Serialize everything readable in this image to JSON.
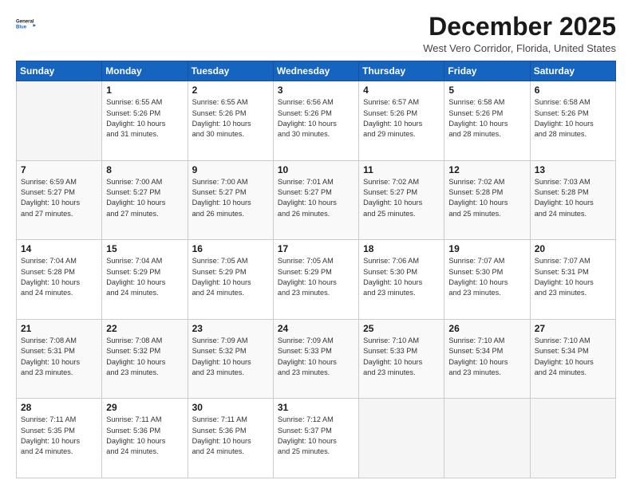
{
  "logo": {
    "line1": "General",
    "line2": "Blue"
  },
  "title": "December 2025",
  "location": "West Vero Corridor, Florida, United States",
  "weekdays": [
    "Sunday",
    "Monday",
    "Tuesday",
    "Wednesday",
    "Thursday",
    "Friday",
    "Saturday"
  ],
  "weeks": [
    [
      {
        "day": "",
        "info": ""
      },
      {
        "day": "1",
        "info": "Sunrise: 6:55 AM\nSunset: 5:26 PM\nDaylight: 10 hours\nand 31 minutes."
      },
      {
        "day": "2",
        "info": "Sunrise: 6:55 AM\nSunset: 5:26 PM\nDaylight: 10 hours\nand 30 minutes."
      },
      {
        "day": "3",
        "info": "Sunrise: 6:56 AM\nSunset: 5:26 PM\nDaylight: 10 hours\nand 30 minutes."
      },
      {
        "day": "4",
        "info": "Sunrise: 6:57 AM\nSunset: 5:26 PM\nDaylight: 10 hours\nand 29 minutes."
      },
      {
        "day": "5",
        "info": "Sunrise: 6:58 AM\nSunset: 5:26 PM\nDaylight: 10 hours\nand 28 minutes."
      },
      {
        "day": "6",
        "info": "Sunrise: 6:58 AM\nSunset: 5:26 PM\nDaylight: 10 hours\nand 28 minutes."
      }
    ],
    [
      {
        "day": "7",
        "info": "Sunrise: 6:59 AM\nSunset: 5:27 PM\nDaylight: 10 hours\nand 27 minutes."
      },
      {
        "day": "8",
        "info": "Sunrise: 7:00 AM\nSunset: 5:27 PM\nDaylight: 10 hours\nand 27 minutes."
      },
      {
        "day": "9",
        "info": "Sunrise: 7:00 AM\nSunset: 5:27 PM\nDaylight: 10 hours\nand 26 minutes."
      },
      {
        "day": "10",
        "info": "Sunrise: 7:01 AM\nSunset: 5:27 PM\nDaylight: 10 hours\nand 26 minutes."
      },
      {
        "day": "11",
        "info": "Sunrise: 7:02 AM\nSunset: 5:27 PM\nDaylight: 10 hours\nand 25 minutes."
      },
      {
        "day": "12",
        "info": "Sunrise: 7:02 AM\nSunset: 5:28 PM\nDaylight: 10 hours\nand 25 minutes."
      },
      {
        "day": "13",
        "info": "Sunrise: 7:03 AM\nSunset: 5:28 PM\nDaylight: 10 hours\nand 24 minutes."
      }
    ],
    [
      {
        "day": "14",
        "info": "Sunrise: 7:04 AM\nSunset: 5:28 PM\nDaylight: 10 hours\nand 24 minutes."
      },
      {
        "day": "15",
        "info": "Sunrise: 7:04 AM\nSunset: 5:29 PM\nDaylight: 10 hours\nand 24 minutes."
      },
      {
        "day": "16",
        "info": "Sunrise: 7:05 AM\nSunset: 5:29 PM\nDaylight: 10 hours\nand 24 minutes."
      },
      {
        "day": "17",
        "info": "Sunrise: 7:05 AM\nSunset: 5:29 PM\nDaylight: 10 hours\nand 23 minutes."
      },
      {
        "day": "18",
        "info": "Sunrise: 7:06 AM\nSunset: 5:30 PM\nDaylight: 10 hours\nand 23 minutes."
      },
      {
        "day": "19",
        "info": "Sunrise: 7:07 AM\nSunset: 5:30 PM\nDaylight: 10 hours\nand 23 minutes."
      },
      {
        "day": "20",
        "info": "Sunrise: 7:07 AM\nSunset: 5:31 PM\nDaylight: 10 hours\nand 23 minutes."
      }
    ],
    [
      {
        "day": "21",
        "info": "Sunrise: 7:08 AM\nSunset: 5:31 PM\nDaylight: 10 hours\nand 23 minutes."
      },
      {
        "day": "22",
        "info": "Sunrise: 7:08 AM\nSunset: 5:32 PM\nDaylight: 10 hours\nand 23 minutes."
      },
      {
        "day": "23",
        "info": "Sunrise: 7:09 AM\nSunset: 5:32 PM\nDaylight: 10 hours\nand 23 minutes."
      },
      {
        "day": "24",
        "info": "Sunrise: 7:09 AM\nSunset: 5:33 PM\nDaylight: 10 hours\nand 23 minutes."
      },
      {
        "day": "25",
        "info": "Sunrise: 7:10 AM\nSunset: 5:33 PM\nDaylight: 10 hours\nand 23 minutes."
      },
      {
        "day": "26",
        "info": "Sunrise: 7:10 AM\nSunset: 5:34 PM\nDaylight: 10 hours\nand 23 minutes."
      },
      {
        "day": "27",
        "info": "Sunrise: 7:10 AM\nSunset: 5:34 PM\nDaylight: 10 hours\nand 24 minutes."
      }
    ],
    [
      {
        "day": "28",
        "info": "Sunrise: 7:11 AM\nSunset: 5:35 PM\nDaylight: 10 hours\nand 24 minutes."
      },
      {
        "day": "29",
        "info": "Sunrise: 7:11 AM\nSunset: 5:36 PM\nDaylight: 10 hours\nand 24 minutes."
      },
      {
        "day": "30",
        "info": "Sunrise: 7:11 AM\nSunset: 5:36 PM\nDaylight: 10 hours\nand 24 minutes."
      },
      {
        "day": "31",
        "info": "Sunrise: 7:12 AM\nSunset: 5:37 PM\nDaylight: 10 hours\nand 25 minutes."
      },
      {
        "day": "",
        "info": ""
      },
      {
        "day": "",
        "info": ""
      },
      {
        "day": "",
        "info": ""
      }
    ]
  ]
}
